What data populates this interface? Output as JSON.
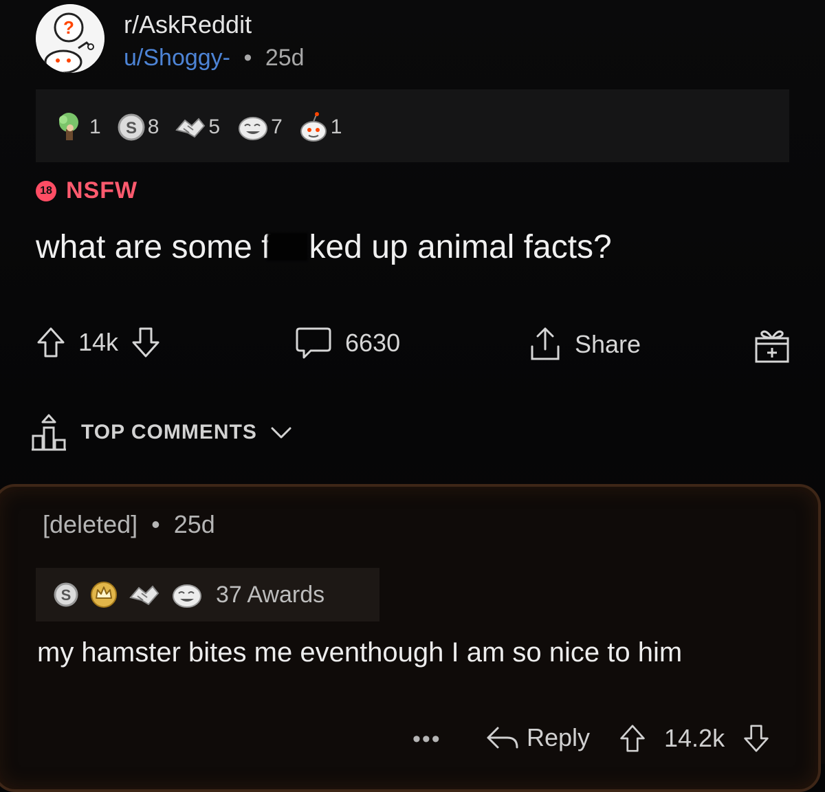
{
  "post": {
    "subreddit": "r/AskReddit",
    "author": "u/Shoggy-",
    "separator": "•",
    "age": "25d",
    "awards": [
      {
        "icon": "wholesome-seal-icon",
        "count": "1"
      },
      {
        "icon": "silver-coin-icon",
        "count": "8"
      },
      {
        "icon": "handshake-icon",
        "count": "5"
      },
      {
        "icon": "laughing-face-icon",
        "count": "7"
      },
      {
        "icon": "snoo-award-icon",
        "count": "1"
      }
    ],
    "nsfw_badge": "18",
    "nsfw_label": "NSFW",
    "title_start": "what are some f",
    "title_end": "ked up animal facts?",
    "upvotes": "14k",
    "comments": "6630",
    "share_label": "Share"
  },
  "sort": {
    "label": "TOP COMMENTS"
  },
  "comment": {
    "author": "[deleted]",
    "separator": "•",
    "age": "25d",
    "awards_count_label": "37 Awards",
    "body": "my hamster bites me eventhough I am so nice to him",
    "more": "•••",
    "reply_label": "Reply",
    "score": "14.2k"
  },
  "colors": {
    "background": "#050506",
    "username_blue": "#4d84d6",
    "nsfw_red": "#ff5a6e",
    "comment_border": "#3e2617"
  }
}
